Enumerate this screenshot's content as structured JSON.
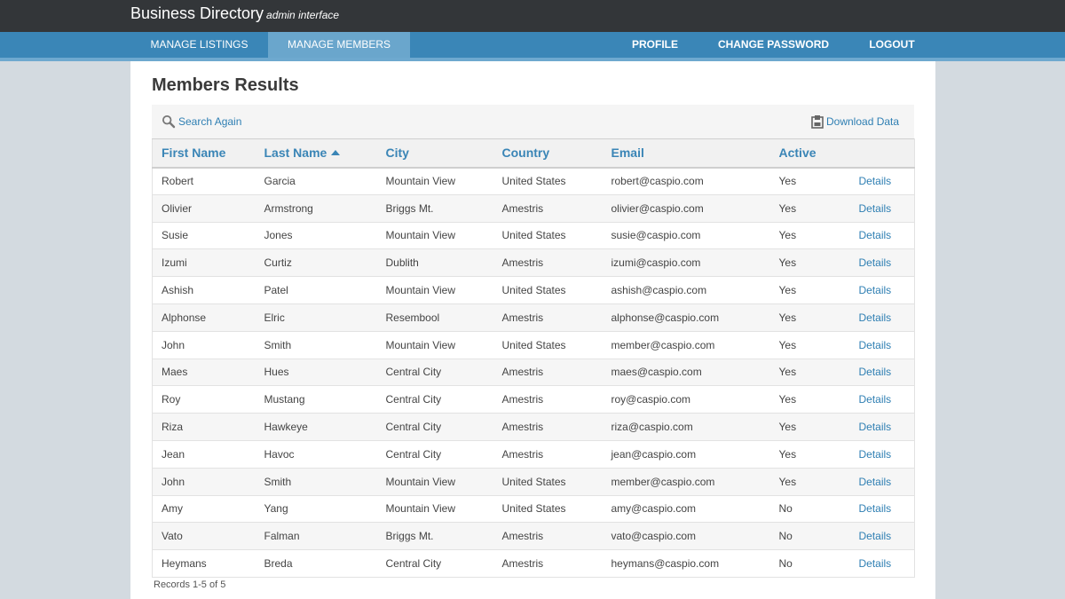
{
  "header": {
    "title": "Business Directory",
    "subtitle": "admin interface"
  },
  "nav": {
    "left": [
      {
        "label": "MANAGE LISTINGS",
        "active": false
      },
      {
        "label": "MANAGE MEMBERS",
        "active": true
      }
    ],
    "right": [
      {
        "label": "PROFILE"
      },
      {
        "label": "CHANGE PASSWORD"
      },
      {
        "label": "LOGOUT"
      }
    ]
  },
  "page": {
    "title": "Members Results",
    "search_again": "Search Again",
    "download_data": "Download Data",
    "records_text": "Records 1-5 of 5"
  },
  "table": {
    "columns": [
      "First Name",
      "Last Name",
      "City",
      "Country",
      "Email",
      "Active",
      ""
    ],
    "sort_column": "Last Name",
    "sort_direction": "ascending",
    "details_label": "Details",
    "rows": [
      [
        "Robert",
        "Garcia",
        "Mountain View",
        "United States",
        "robert@caspio.com",
        "Yes"
      ],
      [
        "Olivier",
        "Armstrong",
        "Briggs Mt.",
        "Amestris",
        "olivier@caspio.com",
        "Yes"
      ],
      [
        "Susie",
        "Jones",
        "Mountain View",
        "United States",
        "susie@caspio.com",
        "Yes"
      ],
      [
        "Izumi",
        "Curtiz",
        "Dublith",
        "Amestris",
        "izumi@caspio.com",
        "Yes"
      ],
      [
        "Ashish",
        "Patel",
        "Mountain View",
        "United States",
        "ashish@caspio.com",
        "Yes"
      ],
      [
        "Alphonse",
        "Elric",
        "Resembool",
        "Amestris",
        "alphonse@caspio.com",
        "Yes"
      ],
      [
        "John",
        "Smith",
        "Mountain View",
        "United States",
        "member@caspio.com",
        "Yes"
      ],
      [
        "Maes",
        "Hues",
        "Central City",
        "Amestris",
        "maes@caspio.com",
        "Yes"
      ],
      [
        "Roy",
        "Mustang",
        "Central City",
        "Amestris",
        "roy@caspio.com",
        "Yes"
      ],
      [
        "Riza",
        "Hawkeye",
        "Central City",
        "Amestris",
        "riza@caspio.com",
        "Yes"
      ],
      [
        "Jean",
        "Havoc",
        "Central City",
        "Amestris",
        "jean@caspio.com",
        "Yes"
      ],
      [
        "John",
        "Smith",
        "Mountain View",
        "United States",
        "member@caspio.com",
        "Yes"
      ],
      [
        "Amy",
        "Yang",
        "Mountain View",
        "United States",
        "amy@caspio.com",
        "No"
      ],
      [
        "Vato",
        "Falman",
        "Briggs Mt.",
        "Amestris",
        "vato@caspio.com",
        "No"
      ],
      [
        "Heymans",
        "Breda",
        "Central City",
        "Amestris",
        "heymans@caspio.com",
        "No"
      ]
    ]
  },
  "icons": {
    "search": "search-icon",
    "download": "download-icon",
    "sort": "sort-ascending-icon"
  },
  "colors": {
    "accent": "#3a86b7",
    "link": "#2f7fb3",
    "topbar": "#333639"
  }
}
